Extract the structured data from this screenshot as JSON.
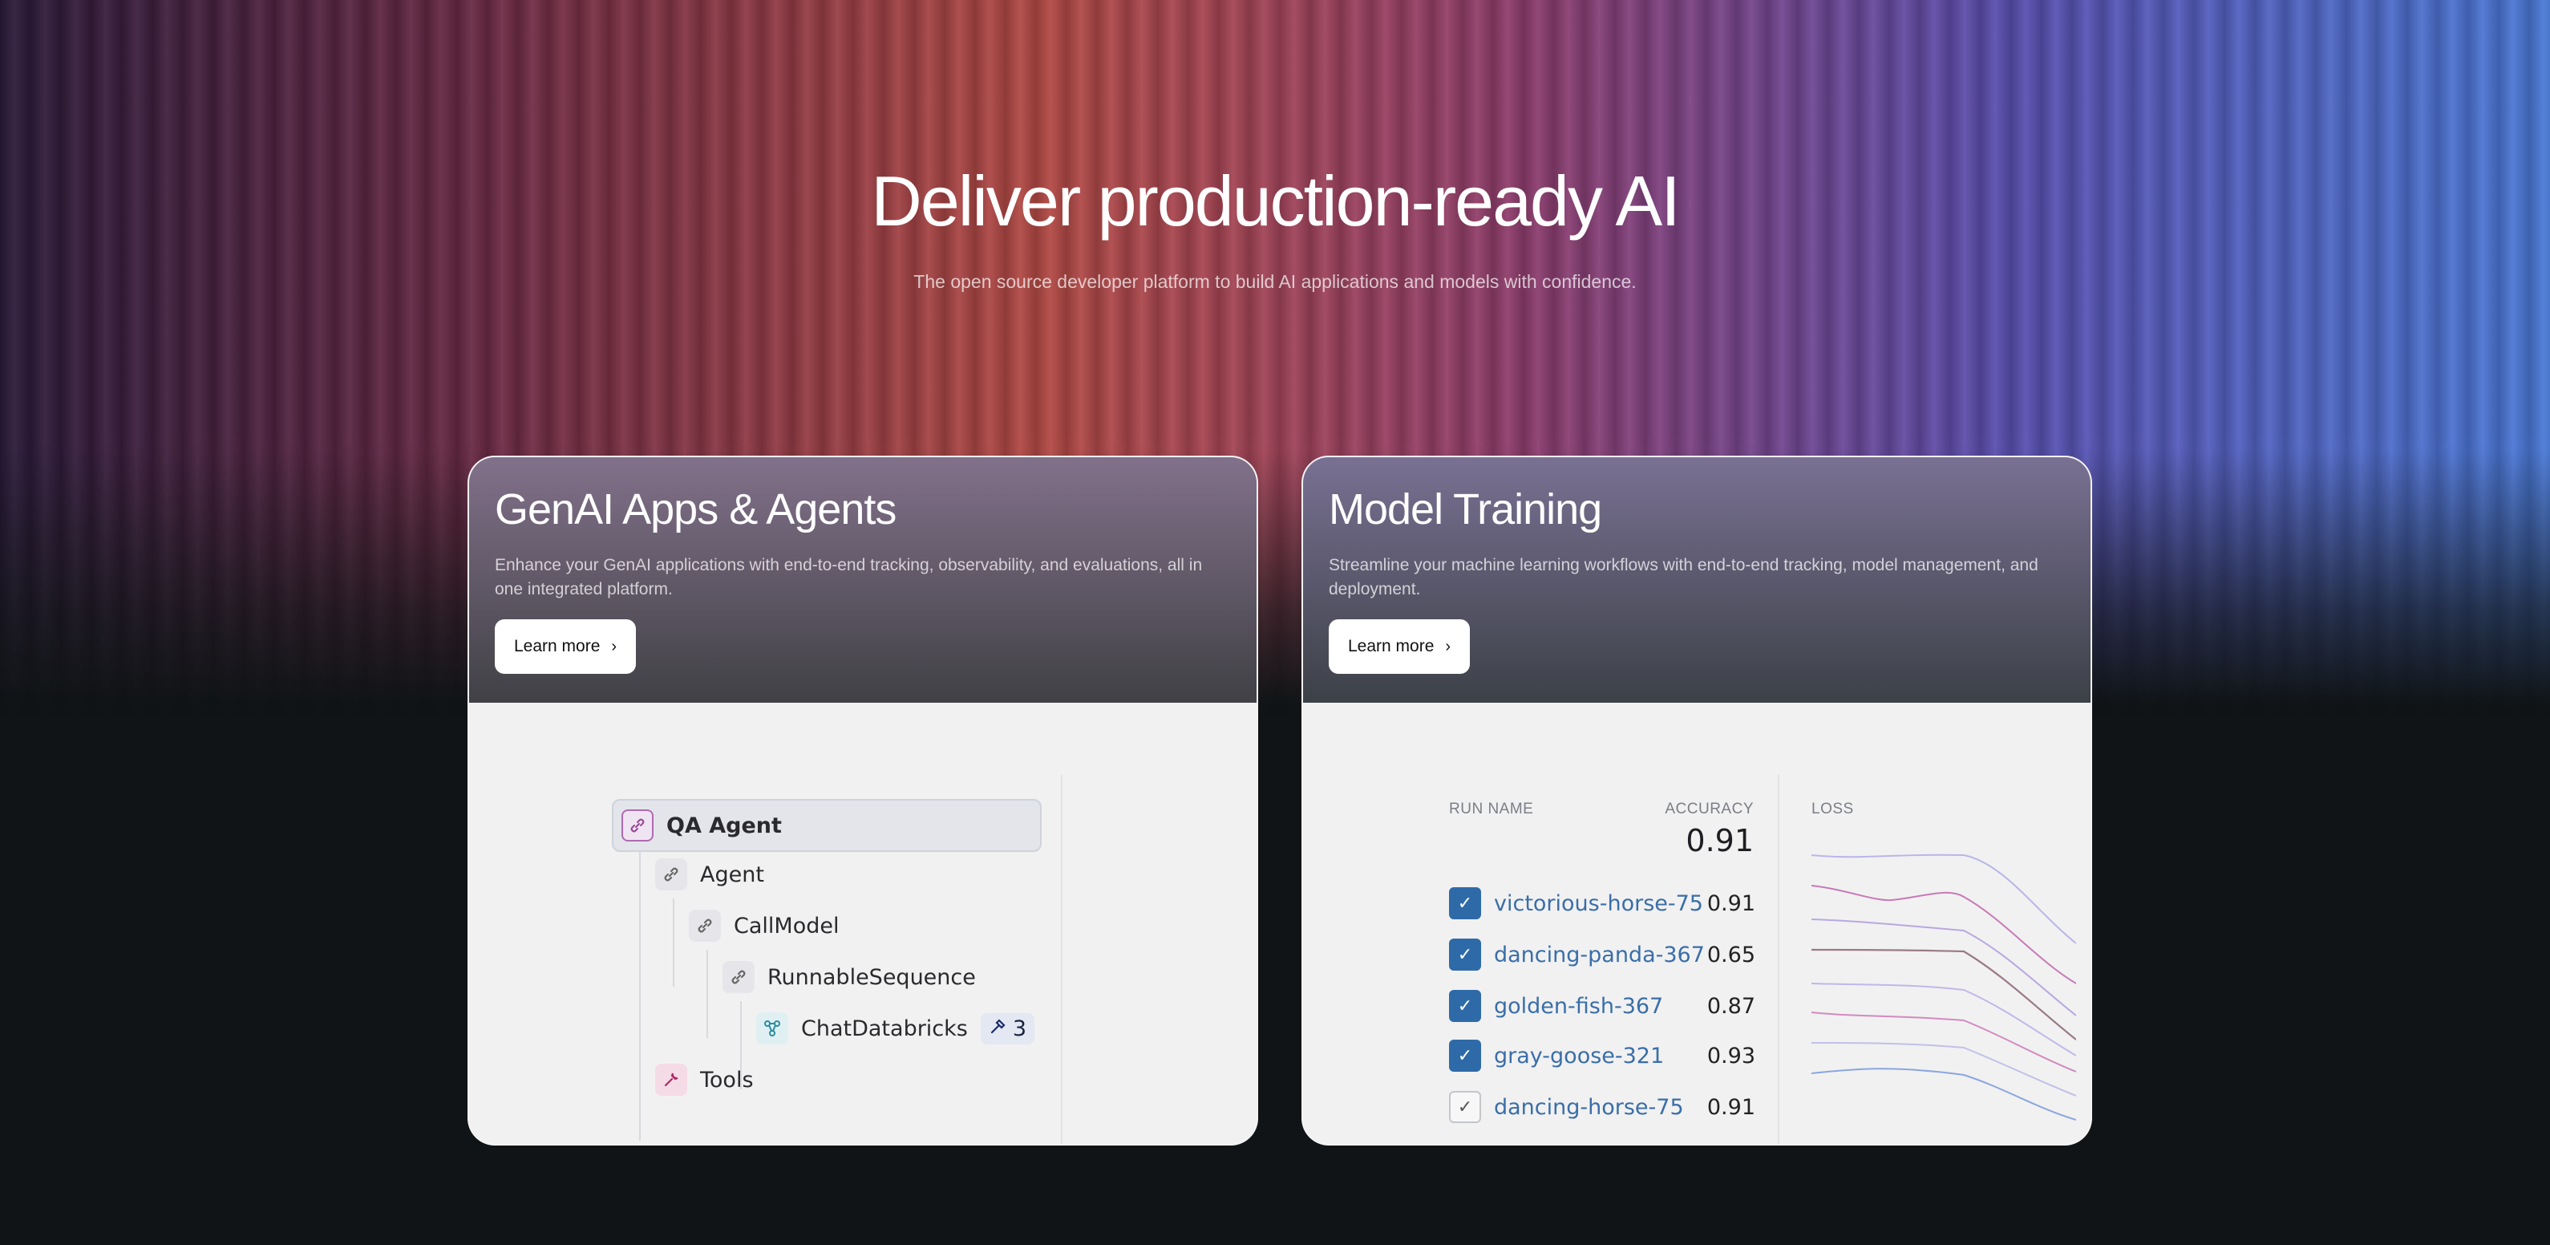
{
  "hero": {
    "title": "Deliver production-ready AI",
    "subtitle": "The open source developer platform to build AI applications and models with confidence."
  },
  "cards": [
    {
      "title": "GenAI Apps & Agents",
      "description": "Enhance your GenAI applications with end-to-end tracking, observability, and evaluations, all in one integrated platform.",
      "button": "Learn more"
    },
    {
      "title": "Model Training",
      "description": "Streamline your machine learning workflows with end-to-end tracking, model management, and deployment.",
      "button": "Learn more"
    }
  ],
  "trace_tree": {
    "root": "QA Agent",
    "nodes": [
      "Agent",
      "CallModel",
      "RunnableSequence",
      "ChatDatabricks",
      "Tools"
    ],
    "badge_count": "3",
    "icons": [
      "link-icon",
      "link-icon",
      "link-icon",
      "link-icon",
      "model-icon",
      "tool-icon"
    ]
  },
  "runs_table": {
    "col_run_name": "RUN NAME",
    "col_accuracy": "ACCURACY",
    "col_loss": "LOSS",
    "best_accuracy": "0.91",
    "rows": [
      {
        "name": "victorious-horse-75",
        "value": "0.91",
        "checked": true
      },
      {
        "name": "dancing-panda-367",
        "value": "0.65",
        "checked": true
      },
      {
        "name": "golden-fish-367",
        "value": "0.87",
        "checked": true
      },
      {
        "name": "gray-goose-321",
        "value": "0.93",
        "checked": true
      },
      {
        "name": "dancing-horse-75",
        "value": "0.91",
        "checked": false
      }
    ]
  },
  "colors": {
    "accent_blue": "#2f6aa8",
    "link_blue": "#3a6ea8"
  }
}
